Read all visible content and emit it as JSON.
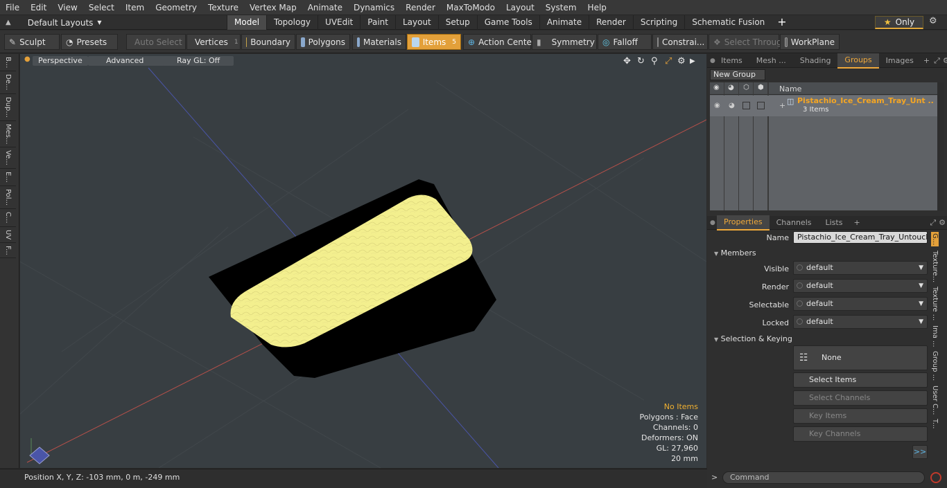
{
  "menu": [
    "File",
    "Edit",
    "View",
    "Select",
    "Item",
    "Geometry",
    "Texture",
    "Vertex Map",
    "Animate",
    "Dynamics",
    "Render",
    "MaxToModo",
    "Layout",
    "System",
    "Help"
  ],
  "layouts_label": "Default Layouts",
  "mode_tabs": [
    "Model",
    "Topology",
    "UVEdit",
    "Paint",
    "Layout",
    "Setup",
    "Game Tools",
    "Animate",
    "Render",
    "Scripting",
    "Schematic Fusion"
  ],
  "only_label": "Only",
  "toolbar": {
    "sculpt": "Sculpt",
    "presets": "Presets",
    "auto_select": "Auto Select",
    "vertices": "Vertices",
    "vertices_count": "1",
    "boundary": "Boundary",
    "polygons": "Polygons",
    "materials": "Materials",
    "items": "Items",
    "items_count": "5",
    "action_center": "Action Center",
    "symmetry": "Symmetry",
    "falloff": "Falloff",
    "constraints": "Constrai...",
    "select_through": "Select Through",
    "workplane": "WorkPlane"
  },
  "left_tabs": [
    "B...",
    "De...",
    "Dup...",
    "Mes...",
    "Ve...",
    "E...",
    "Pol...",
    "C...",
    "UV",
    "F..."
  ],
  "viewport": {
    "perspective": "Perspective",
    "advanced": "Advanced",
    "raygl": "Ray GL: Off",
    "stats": {
      "no_items": "No Items",
      "polygons": "Polygons : Face",
      "channels": "Channels: 0",
      "deformers": "Deformers: ON",
      "gl": "GL: 27,960",
      "scale": "20 mm"
    }
  },
  "status_position": "Position X, Y, Z:  -103 mm, 0 m, -249 mm",
  "groups_panel": {
    "tabs": [
      "Items",
      "Mesh ...",
      "Shading",
      "Groups",
      "Images"
    ],
    "active_tab": "Groups",
    "new_group": "New Group",
    "col_name": "Name",
    "group_name": "Pistachio_Ice_Cream_Tray_Unt ...",
    "group_count": "3 Items"
  },
  "properties_panel": {
    "tabs": [
      "Properties",
      "Channels",
      "Lists"
    ],
    "name_label": "Name",
    "name_value": "Pistachio_Ice_Cream_Tray_Untouched",
    "members_label": "Members",
    "visible_label": "Visible",
    "visible_value": "default",
    "render_label": "Render",
    "render_value": "default",
    "selectable_label": "Selectable",
    "selectable_value": "default",
    "locked_label": "Locked",
    "locked_value": "default",
    "selection_keying_label": "Selection & Keying",
    "none_label": "None",
    "select_items": "Select Items",
    "select_channels": "Select Channels",
    "key_items": "Key Items",
    "key_channels": "Key Channels",
    "more": ">>"
  },
  "side_tabs": [
    "G...",
    "Texture...",
    "Texture ...",
    "Ima ...",
    "Group ...",
    "User C...",
    "T..."
  ],
  "command_placeholder": "Command",
  "colors": {
    "accent": "#e3a03a",
    "group_name": "#f5a623",
    "tray_fill": "#f3ef8e"
  }
}
